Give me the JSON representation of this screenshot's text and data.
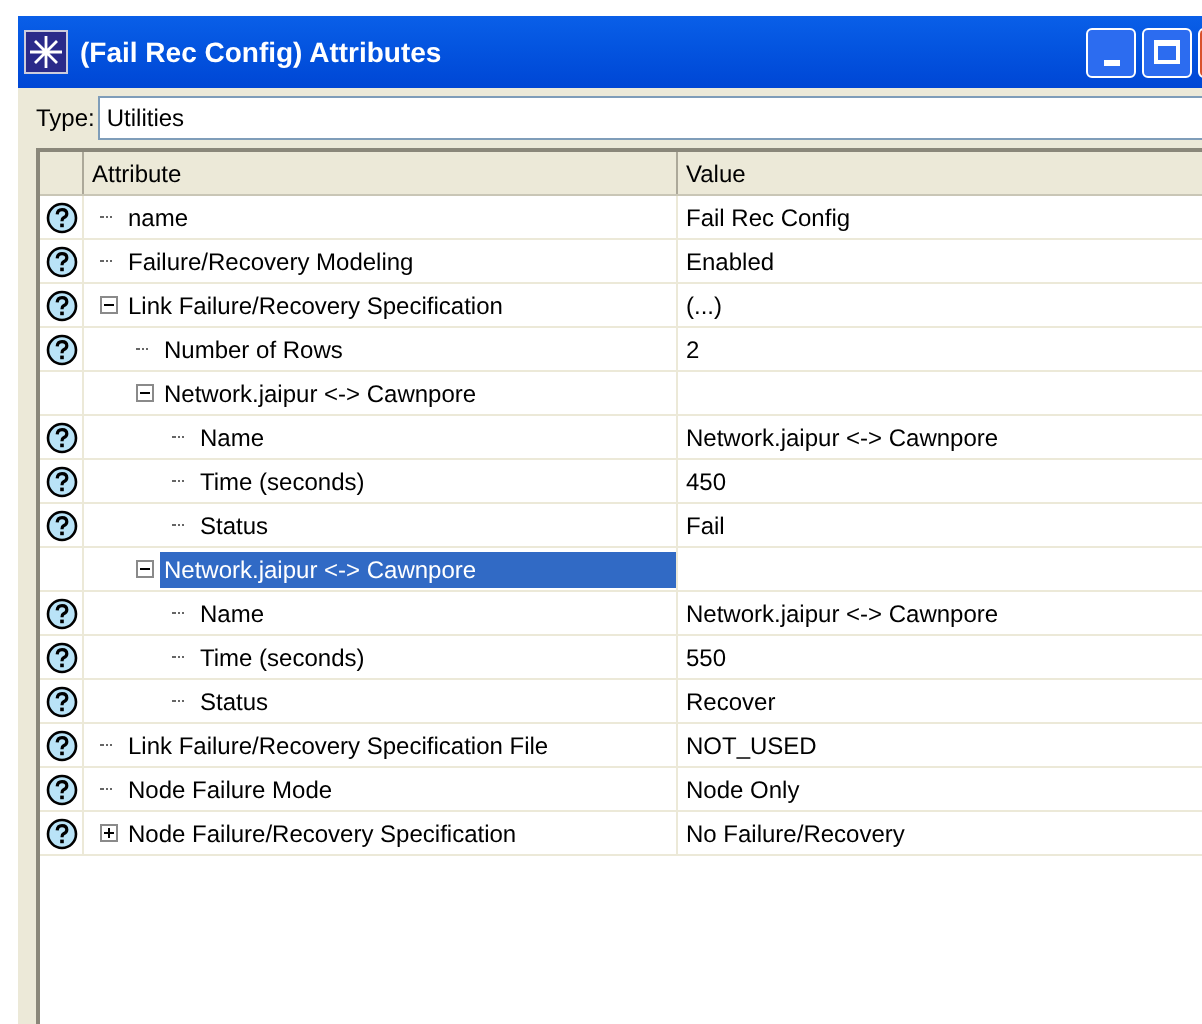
{
  "window": {
    "title": "(Fail Rec Config) Attributes"
  },
  "type_field": {
    "label": "Type:",
    "value": "Utilities"
  },
  "table": {
    "columns": [
      "Attribute",
      "Value"
    ],
    "rows": [
      {
        "attribute": "name",
        "value": "Fail Rec Config",
        "help": true,
        "selected": false
      },
      {
        "attribute": "Failure/Recovery Modeling",
        "value": "Enabled",
        "help": true,
        "selected": false
      },
      {
        "attribute": "Link Failure/Recovery Specification",
        "value": "(...)",
        "help": true,
        "selected": false,
        "expanded": true,
        "children": [
          {
            "attribute": "Number of Rows",
            "value": "2",
            "help": true,
            "selected": false
          },
          {
            "attribute": "Network.jaipur <-> Cawnpore",
            "help": false,
            "selected": false,
            "expanded": true,
            "children": [
              {
                "attribute": "Name",
                "value": "Network.jaipur <-> Cawnpore",
                "help": true,
                "selected": false
              },
              {
                "attribute": "Time (seconds)",
                "value": "450",
                "help": true,
                "selected": false
              },
              {
                "attribute": "Status",
                "value": "Fail",
                "help": true,
                "selected": false
              }
            ]
          },
          {
            "attribute": "Network.jaipur <-> Cawnpore",
            "help": false,
            "selected": true,
            "expanded": true,
            "children": [
              {
                "attribute": "Name",
                "value": "Network.jaipur <-> Cawnpore",
                "help": true,
                "selected": false
              },
              {
                "attribute": "Time (seconds)",
                "value": "550",
                "help": true,
                "selected": false
              },
              {
                "attribute": "Status",
                "value": "Recover",
                "help": true,
                "selected": false
              }
            ]
          }
        ]
      },
      {
        "attribute": "Link Failure/Recovery Specification File",
        "value": "NOT_USED",
        "help": true,
        "selected": false
      },
      {
        "attribute": "Node Failure Mode",
        "value": "Node Only",
        "help": true,
        "selected": false
      },
      {
        "attribute": "Node Failure/Recovery Specification",
        "value": "No Failure/Recovery",
        "help": true,
        "selected": false,
        "expanded": false,
        "children": []
      }
    ]
  }
}
